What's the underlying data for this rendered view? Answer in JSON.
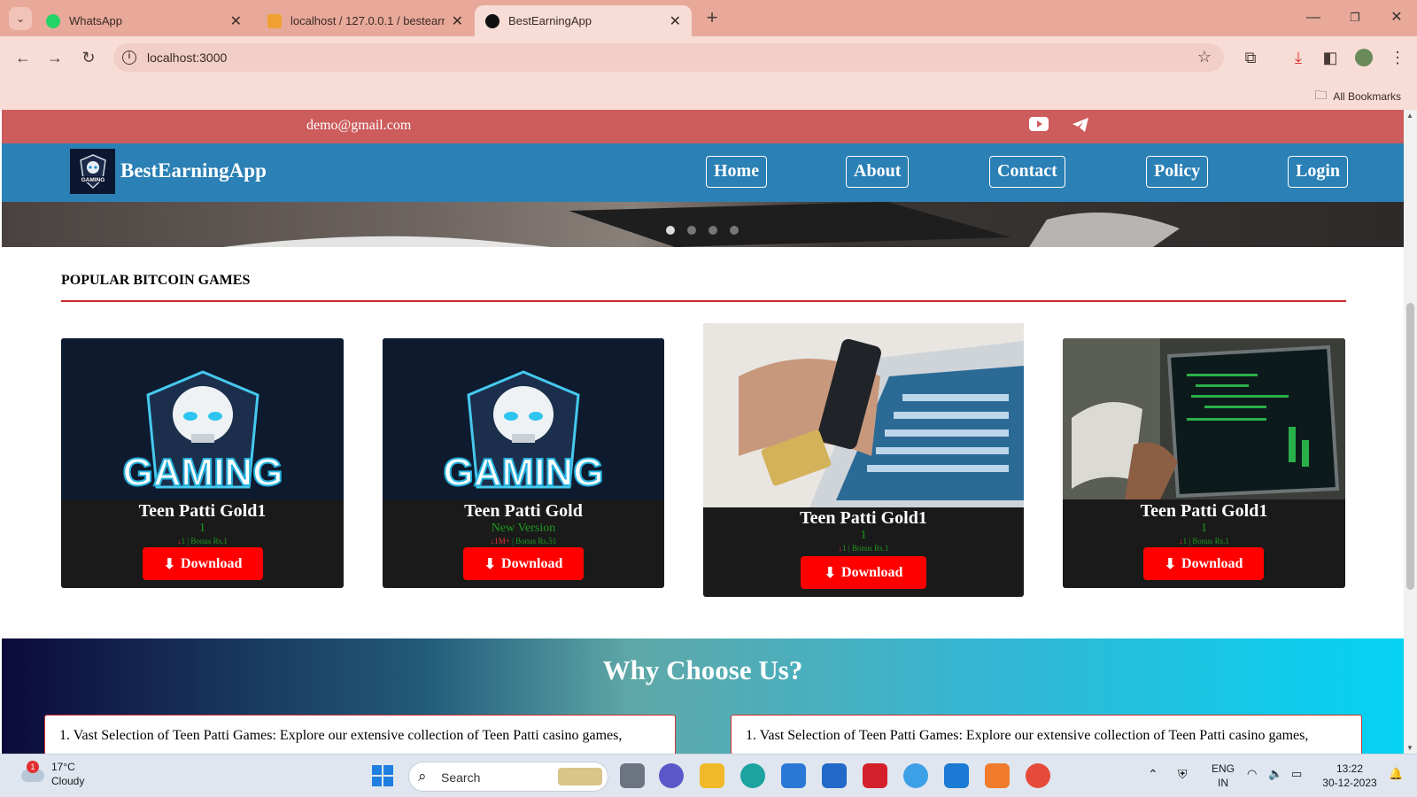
{
  "browser": {
    "tabs": [
      {
        "title": "WhatsApp",
        "icon": "whatsapp-icon"
      },
      {
        "title": "localhost / 127.0.0.1 / bestearn",
        "icon": "phpmyadmin-icon"
      },
      {
        "title": "BestEarningApp",
        "icon": "site-icon"
      }
    ],
    "url": "localhost:3000",
    "bookmarks_label": "All Bookmarks"
  },
  "site": {
    "email": "demo@gmail.com",
    "brand": "BestEarningApp",
    "logo_text": "GAMING",
    "nav": [
      "Home",
      "About",
      "Contact",
      "Policy",
      "Login"
    ],
    "section_title": "POPULAR BITCOIN GAMES",
    "download_label": "Download",
    "cards": [
      {
        "name": "Teen Patti Gold1",
        "version": "1",
        "downloads": "1",
        "bonus": "| Bonus Rs.1"
      },
      {
        "name": "Teen Patti Gold",
        "version": "New Version",
        "downloads": "1M+",
        "bonus": "| Bonus Rs.51"
      },
      {
        "name": "Teen Patti Gold1",
        "version": "1",
        "downloads": "1",
        "bonus": "| Bonus Rs.1"
      },
      {
        "name": "Teen Patti Gold1",
        "version": "1",
        "downloads": "1",
        "bonus": "| Bonus Rs.1"
      }
    ],
    "why_title": "Why Choose Us?",
    "why_text": "1. Vast Selection of Teen Patti Games: Explore our extensive collection of Teen Patti casino games,"
  },
  "taskbar": {
    "weather_temp": "17°C",
    "weather_desc": "Cloudy",
    "weather_badge": "1",
    "search_label": "Search",
    "lang": "ENG",
    "region": "IN",
    "time": "13:22",
    "date": "30-12-2023"
  },
  "colors": {
    "tabbar": "#e8a99a",
    "topbar": "#cd5c5c",
    "navbar": "#2b80b5",
    "download": "#ff0000"
  }
}
